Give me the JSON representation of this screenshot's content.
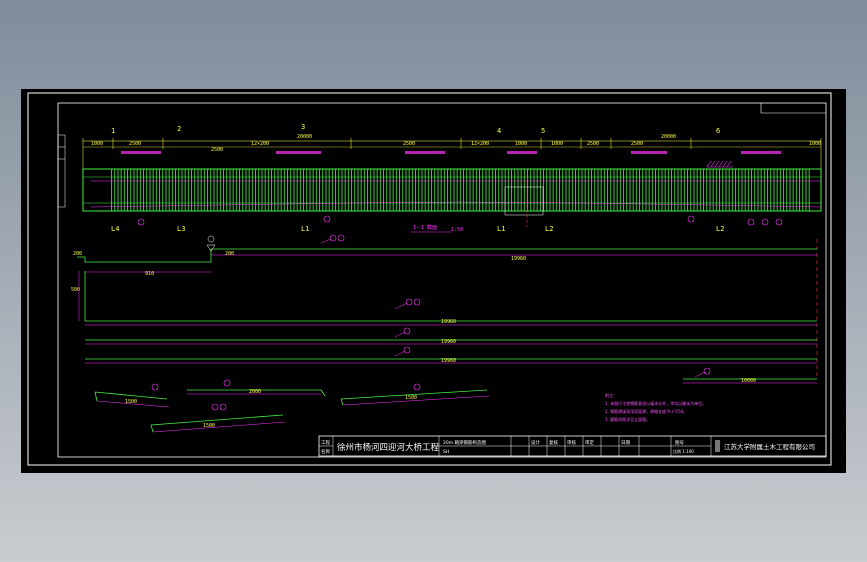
{
  "colors": {
    "background_top": "#7f8c9b",
    "background_bottom": "#c9ccd0",
    "canvas": "#000000",
    "frame": "#ffffff",
    "rebar": "#44ee44",
    "dimension": "#ff33ff",
    "annotation": "#ffff44",
    "note": "#ff55ff",
    "center_line": "#ff3333"
  },
  "title_block": {
    "project_name": "徐州市杨河四迎河大桥工程",
    "company": "江苏大学附属土木工程有限公司",
    "cell_top_left": "工程",
    "cell_bottom_left": "名称",
    "drawing_name": "20m 箱梁钢筋构造图",
    "sheet_label": "SH",
    "marks": [
      "设计",
      "复核",
      "审核",
      "审定",
      "日期",
      "图号"
    ],
    "scale_label": "比例 1:100"
  },
  "elevation": {
    "section_label": "I－I 截面",
    "scale_note": "1:50",
    "dimensions": {
      "d_left_end": "1000",
      "d_a": "2500",
      "d_b": "2500",
      "d_c": "12×200",
      "d_d": "2500",
      "d_e": "12×200",
      "d_f": "1000",
      "d_g": "1000",
      "d_h": "2500",
      "d_i": "2500",
      "d_right_end": "1000",
      "d_total_right": "20000",
      "d_total_center": "20000"
    },
    "bar_marks_top": [
      "1",
      "2",
      "3",
      "4",
      "5",
      "6"
    ],
    "section_marks_bottom": [
      "L4",
      "L3",
      "L1",
      "L1",
      "L2",
      "L2"
    ]
  },
  "bars": {
    "bar1_length": "19960",
    "bar1_hook": "200",
    "bar1_left": "910",
    "bar1_height": "500",
    "bar2_length": "19960",
    "bar3_length": "19960",
    "bar4_length": "19960",
    "bar5_length": "10000"
  },
  "details": {
    "d1": "1500",
    "d2": "2000",
    "d3": "1500",
    "d4": "1500",
    "d5": "1500"
  },
  "notes": {
    "title": "附注：",
    "line1": "1. 本图尺寸除钢筋直径以毫米计外，余均以厘米为单位。",
    "line2": "2. 钢筋焊接采用双面焊，焊缝长度不小于5d。",
    "line3": "3. 箍筋间距详见立面图。"
  }
}
